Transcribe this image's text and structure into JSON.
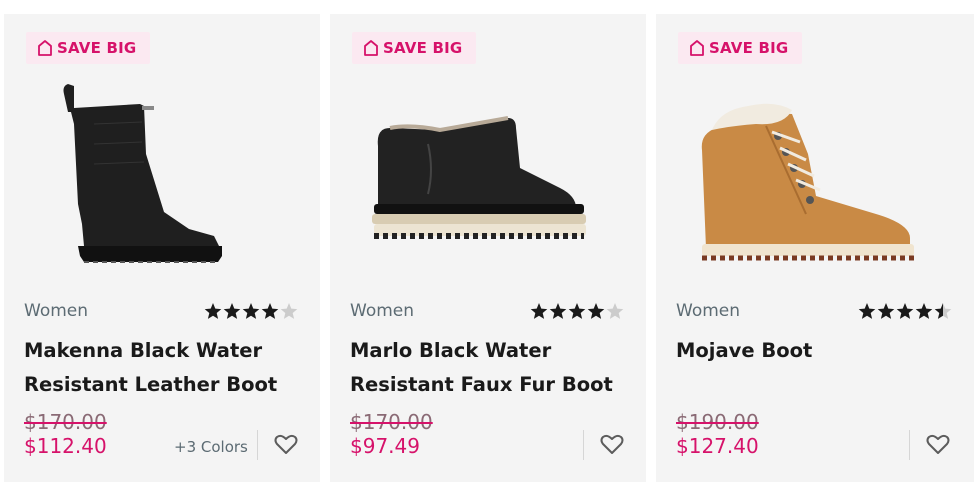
{
  "products": [
    {
      "badge": "SAVE BIG",
      "image_icon": "black-leather-boot-image",
      "category": "Women",
      "rating": 4,
      "name": "Makenna Black Water Resistant Leather Boot",
      "was_price": "$170.00",
      "price": "$112.40",
      "colors": "+3 Colors"
    },
    {
      "badge": "SAVE BIG",
      "image_icon": "black-faux-fur-bootie-image",
      "category": "Women",
      "rating": 4,
      "name": "Marlo Black Water Resistant Faux Fur Boot",
      "was_price": "$170.00",
      "price": "$97.49",
      "colors": ""
    },
    {
      "badge": "SAVE BIG",
      "image_icon": "tan-hiker-boot-image",
      "category": "Women",
      "rating": 4.5,
      "name": "Mojave Boot",
      "was_price": "$190.00",
      "price": "$127.40",
      "colors": ""
    }
  ],
  "colors": {
    "accent": "#d6126a",
    "badge_bg": "#fbe9f1",
    "card_bg": "#f4f4f4",
    "star": "#1a1a1a",
    "star_empty": "#cccccc"
  },
  "icons": {
    "badge": "tag-icon",
    "wishlist": "heart-icon",
    "rating": "star-icon"
  }
}
